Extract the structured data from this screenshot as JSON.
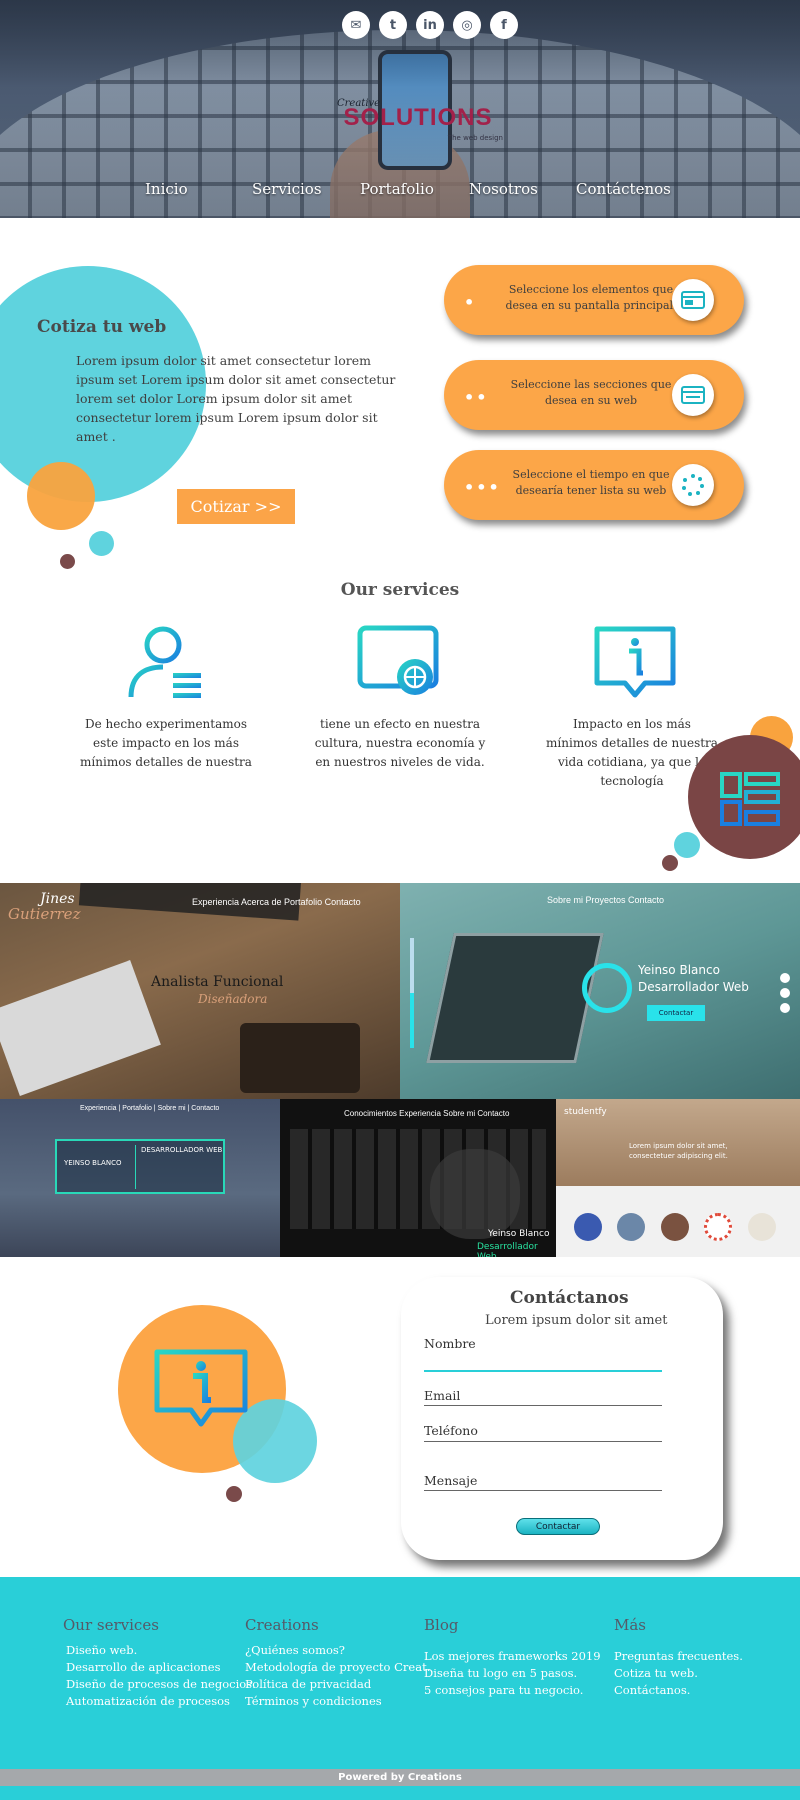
{
  "colors": {
    "accent_orange": "#fca648",
    "accent_cyan": "#29cfd8",
    "accent_brown": "#7a4a4a",
    "text_dark": "#3f3f3f"
  },
  "header": {
    "social_icons": [
      {
        "name": "mail-icon",
        "glyph": "✉"
      },
      {
        "name": "twitter-icon",
        "glyph": "t"
      },
      {
        "name": "linkedin-icon",
        "glyph": "in"
      },
      {
        "name": "instagram-icon",
        "glyph": "◎"
      },
      {
        "name": "facebook-icon",
        "glyph": "f"
      }
    ],
    "logo": {
      "small": "Creative",
      "main": "SOLUTIONS",
      "tag": "The web design"
    },
    "nav": [
      "Inicio",
      "Servicios",
      "Portafolio",
      "Nosotros",
      "Contáctenos"
    ]
  },
  "quote": {
    "title": "Cotiza tu web",
    "body": "Lorem ipsum dolor sit amet consectetur lorem ipsum set Lorem ipsum dolor sit amet consectetur lorem set dolor Lorem ipsum dolor sit amet consectetur lorem ipsum Lorem ipsum dolor sit amet .",
    "button": "Cotizar >>",
    "steps": [
      {
        "dots": "•",
        "text": "Seleccione los elementos que desea en su pantalla principal.",
        "icon": "browser-window-icon"
      },
      {
        "dots": "••",
        "text": "Seleccione las secciones que desea en su web",
        "icon": "browser-sections-icon"
      },
      {
        "dots": "•••",
        "text": "Seleccione el tiempo en que desearía tener lista su web",
        "icon": "loading-icon"
      }
    ]
  },
  "services": {
    "title": "Our services",
    "items": [
      {
        "icon": "user-list-icon",
        "text": "De hecho experimentamos\neste impacto en los más\nmínimos detalles de nuestra"
      },
      {
        "icon": "web-globe-icon",
        "text": "tiene un efecto en nuestra\ncultura, nuestra economía y\nen nuestros niveles de vida."
      },
      {
        "icon": "info-chat-icon",
        "text": "Impacto en los más\nmínimos detalles de nuestra\nvida cotidiana, ya que la tecnología"
      }
    ]
  },
  "portfolio": {
    "items": [
      {
        "nav": "Experiencia  Acerca de  Portafolio  Contacto",
        "name1": "Jines",
        "name2": "Gutierrez",
        "title": "Analista Funcional",
        "subtitle": "Diseñadora"
      },
      {
        "nav": "Sobre mi   Proyectos   Contacto",
        "title": "Yeinso Blanco",
        "subtitle": "Desarrollador Web",
        "button": "Contactar"
      },
      {
        "nav": "Experiencia | Portafolio | Sobre mi | Contacto",
        "left": "YEINSO BLANCO",
        "right": "DESARROLLADOR WEB"
      },
      {
        "nav": "Conocimientos   Experiencia   Sobre mi   Contacto",
        "title": "Yeinso Blanco",
        "subtitle": "Desarrollador Web"
      },
      {
        "brand": "studentfy",
        "text": "Lorem ipsum dolor sit amet, consectetuer adipiscing elit."
      }
    ]
  },
  "contact": {
    "title": "Contáctanos",
    "subtitle": "Lorem ipsum dolor sit amet",
    "fields": [
      "Nombre",
      "Email",
      "Teléfono",
      "Mensaje"
    ],
    "button": "Contactar"
  },
  "footer": {
    "columns": [
      {
        "title": "Our services",
        "items": [
          "Diseño web.",
          "Desarrollo de aplicaciones",
          "Diseño de procesos de negocios.",
          "Automatización de procesos"
        ]
      },
      {
        "title": "Creations",
        "items": [
          "¿Quiénes somos?",
          "Metodología de proyecto Creat.",
          "Política de privacidad",
          "Términos y condiciones"
        ]
      },
      {
        "title": "Blog",
        "items": [
          "Los mejores frameworks 2019",
          "Diseña tu logo en 5 pasos.",
          "5 consejos para tu negocio."
        ]
      },
      {
        "title": "Más",
        "items": [
          "Preguntas frecuentes.",
          "Cotiza tu web.",
          "Contáctanos."
        ]
      }
    ],
    "powered": "Powered by Creations"
  }
}
